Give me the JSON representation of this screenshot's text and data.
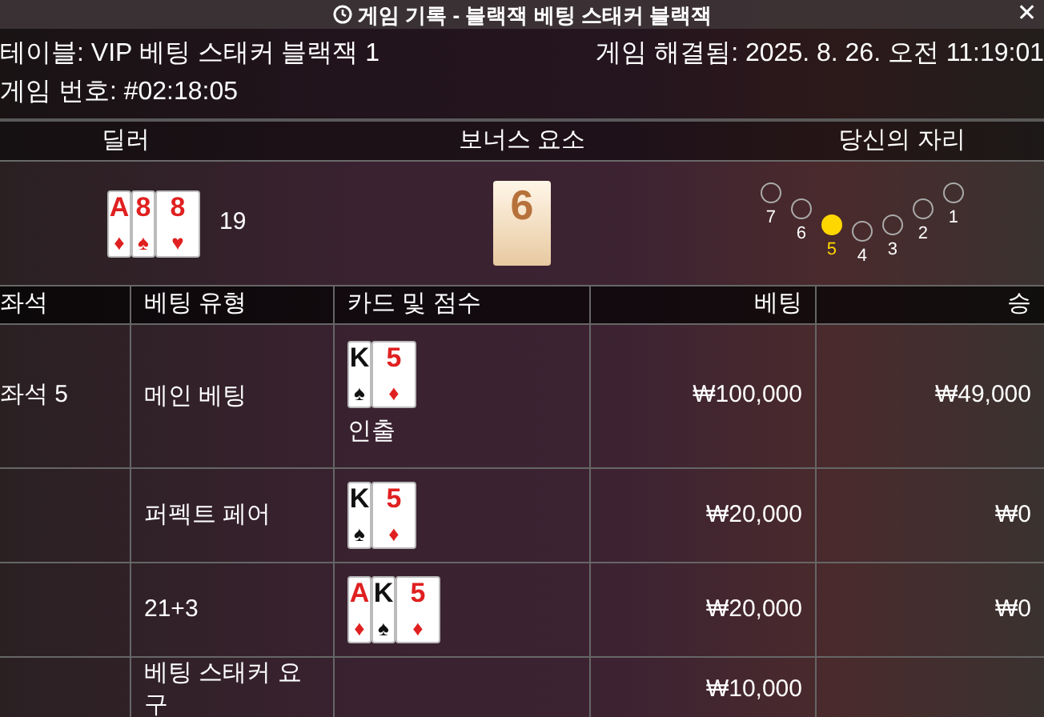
{
  "window": {
    "title": "게임 기록 - 블랙잭 베팅 스태커 블랙잭",
    "close": "✕"
  },
  "info": {
    "table": "테이블: VIP 베팅 스태커 블랙잭 1",
    "resolved": "게임 해결됨: 2025. 8. 26. 오전 11:19:01",
    "game_number": "게임 번호: #02:18:05"
  },
  "sections": [
    "딜러",
    "보너스 요소",
    "당신의 자리"
  ],
  "dealer": {
    "cards": [
      {
        "rank": "A",
        "suit": "♦",
        "color": "#e02020"
      },
      {
        "rank": "8",
        "suit": "♠",
        "color": "#e02020"
      },
      {
        "rank": "8",
        "suit": "♥",
        "color": "#e02020"
      }
    ],
    "score": "19"
  },
  "bonus": {
    "value": "6"
  },
  "seats": [
    {
      "label": "7",
      "selected": false
    },
    {
      "label": "6",
      "selected": false
    },
    {
      "label": "5",
      "selected": true
    },
    {
      "label": "4",
      "selected": false
    },
    {
      "label": "3",
      "selected": false
    },
    {
      "label": "2",
      "selected": false
    },
    {
      "label": "1",
      "selected": false
    }
  ],
  "table": {
    "columns": [
      "좌석",
      "베팅 유형",
      "카드 및 점수",
      "베팅",
      "승"
    ],
    "rows": [
      {
        "seat": "좌석 5",
        "type": "메인 베팅",
        "cards": [
          {
            "rank": "K",
            "suit": "♠",
            "color": "#111111"
          },
          {
            "rank": "5",
            "suit": "♦",
            "color": "#e02020"
          }
        ],
        "note": "인출",
        "bet": "₩100,000",
        "win": "₩49,000"
      },
      {
        "type": "퍼펙트 페어",
        "cards": [
          {
            "rank": "K",
            "suit": "♠",
            "color": "#111111"
          },
          {
            "rank": "5",
            "suit": "♦",
            "color": "#e02020"
          }
        ],
        "bet": "₩20,000",
        "win": "₩0"
      },
      {
        "type": "21+3",
        "cards": [
          {
            "rank": "A",
            "suit": "♦",
            "color": "#e02020"
          },
          {
            "rank": "K",
            "suit": "♠",
            "color": "#111111"
          },
          {
            "rank": "5",
            "suit": "♦",
            "color": "#e02020"
          }
        ],
        "bet": "₩20,000",
        "win": "₩0"
      },
      {
        "type": "베팅 스태커 요구",
        "bet": "₩10,000"
      }
    ]
  }
}
